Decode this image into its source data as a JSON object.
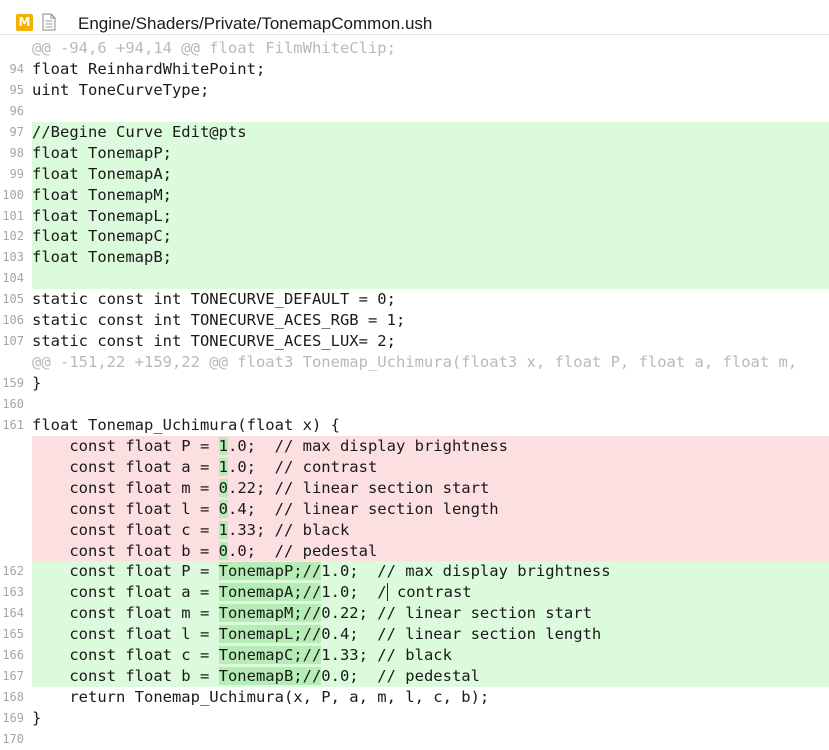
{
  "header": {
    "badge": "M",
    "file_icon": "file-icon",
    "path": "Engine/Shaders/Private/TonemapCommon.ush"
  },
  "lines": [
    {
      "num": "",
      "type": "hunk",
      "text": "@@ -94,6 +94,14 @@ float FilmWhiteClip;"
    },
    {
      "num": "94",
      "type": "ctx",
      "text": "float ReinhardWhitePoint;"
    },
    {
      "num": "95",
      "type": "ctx",
      "text": "uint ToneCurveType;"
    },
    {
      "num": "96",
      "type": "ctx",
      "text": ""
    },
    {
      "num": "97",
      "type": "added",
      "text": "//Begine Curve Edit@pts"
    },
    {
      "num": "98",
      "type": "added",
      "text": "float TonemapP;"
    },
    {
      "num": "99",
      "type": "added",
      "text": "float TonemapA;"
    },
    {
      "num": "100",
      "type": "added",
      "text": "float TonemapM;"
    },
    {
      "num": "101",
      "type": "added",
      "text": "float TonemapL;"
    },
    {
      "num": "102",
      "type": "added",
      "text": "float TonemapC;"
    },
    {
      "num": "103",
      "type": "added",
      "text": "float TonemapB;"
    },
    {
      "num": "104",
      "type": "added",
      "text": ""
    },
    {
      "num": "105",
      "type": "ctx",
      "text": "static const int TONECURVE_DEFAULT = 0;"
    },
    {
      "num": "106",
      "type": "ctx",
      "text": "static const int TONECURVE_ACES_RGB = 1;"
    },
    {
      "num": "107",
      "type": "ctx",
      "text": "static const int TONECURVE_ACES_LUX= 2;"
    },
    {
      "num": "",
      "type": "hunk",
      "text": "@@ -151,22 +159,22 @@ float3 Tonemap_Uchimura(float3 x, float P, float a, float m,"
    },
    {
      "num": "159",
      "type": "ctx",
      "text": "}"
    },
    {
      "num": "160",
      "type": "ctx",
      "text": ""
    },
    {
      "num": "161",
      "type": "ctx",
      "text": "float Tonemap_Uchimura(float x) {"
    },
    {
      "num": "",
      "type": "removed",
      "prefix": "    const float P = ",
      "hl": "1",
      "suffix": ".0;  // max display brightness"
    },
    {
      "num": "",
      "type": "removed",
      "prefix": "    const float a = ",
      "hl": "1",
      "suffix": ".0;  // contrast"
    },
    {
      "num": "",
      "type": "removed",
      "prefix": "    const float m = ",
      "hl": "0",
      "suffix": ".22; // linear section start"
    },
    {
      "num": "",
      "type": "removed",
      "prefix": "    const float l = ",
      "hl": "0",
      "suffix": ".4;  // linear section length"
    },
    {
      "num": "",
      "type": "removed",
      "prefix": "    const float c = ",
      "hl": "1",
      "suffix": ".33; // black"
    },
    {
      "num": "",
      "type": "removed",
      "prefix": "    const float b = ",
      "hl": "0",
      "suffix": ".0;  // pedestal"
    },
    {
      "num": "162",
      "type": "added",
      "prefix": "    const float P = ",
      "hl": "TonemapP;//",
      "suffix": "1.0;  // max display brightness"
    },
    {
      "num": "163",
      "type": "added",
      "prefix": "    const float a = ",
      "hl": "TonemapA;//",
      "suffix": "1.0;  / contrast",
      "cursor": true
    },
    {
      "num": "164",
      "type": "added",
      "prefix": "    const float m = ",
      "hl": "TonemapM;//",
      "suffix": "0.22; // linear section start"
    },
    {
      "num": "165",
      "type": "added",
      "prefix": "    const float l = ",
      "hl": "TonemapL;//",
      "suffix": "0.4;  // linear section length"
    },
    {
      "num": "166",
      "type": "added",
      "prefix": "    const float c = ",
      "hl": "TonemapC;//",
      "suffix": "1.33; // black"
    },
    {
      "num": "167",
      "type": "added",
      "prefix": "    const float b = ",
      "hl": "TonemapB;//",
      "suffix": "0.0;  // pedestal"
    },
    {
      "num": "168",
      "type": "ctx",
      "text": "    return Tonemap_Uchimura(x, P, a, m, l, c, b);"
    },
    {
      "num": "169",
      "type": "ctx",
      "text": "}"
    },
    {
      "num": "170",
      "type": "ctx",
      "text": ""
    }
  ]
}
